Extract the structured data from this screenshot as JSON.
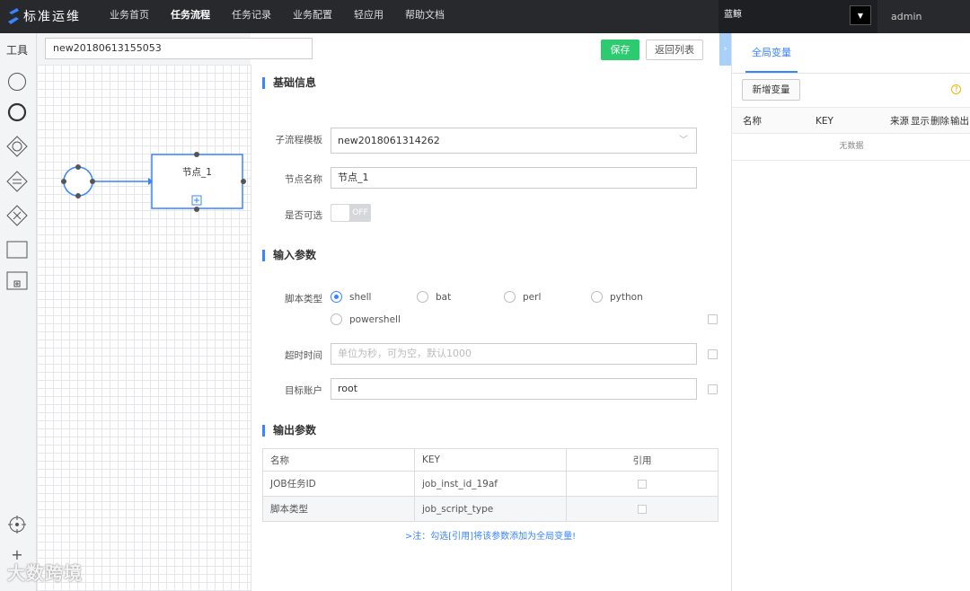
{
  "app": {
    "logo_text": "标准运维"
  },
  "nav": {
    "items": [
      "业务首页",
      "任务流程",
      "任务记录",
      "业务配置",
      "轻应用",
      "帮助文档"
    ],
    "active_index": 1
  },
  "header": {
    "business": "蓝鲸",
    "user": "admin"
  },
  "toolbox": {
    "title": "工具",
    "tools": [
      "start-node-icon",
      "end-node-icon",
      "parallel-gateway-icon",
      "branch-gateway-icon",
      "converge-gateway-icon",
      "task-node-icon",
      "subprocess-node-icon"
    ],
    "bottom_tools": [
      "locate-icon",
      "zoom-in-icon"
    ]
  },
  "flow": {
    "name": "new20180613155053",
    "save_label": "保存",
    "back_label": "返回列表"
  },
  "canvas": {
    "node_label": "节点_1"
  },
  "basic_info": {
    "title": "基础信息",
    "template_label": "子流程模板",
    "template_value": "new2018061314262",
    "node_name_label": "节点名称",
    "node_name_value": "节点_1",
    "optional_label": "是否可选",
    "optional_value": "OFF"
  },
  "input_params": {
    "title": "输入参数",
    "script_type_label": "脚本类型",
    "script_types": [
      "shell",
      "bat",
      "perl",
      "python",
      "powershell"
    ],
    "selected": "shell",
    "timeout_label": "超时时间",
    "timeout_placeholder": "单位为秒，可为空，默认1000",
    "account_label": "目标账户",
    "account_value": "root"
  },
  "output_params": {
    "title": "输出参数",
    "columns": [
      "名称",
      "KEY",
      "引用"
    ],
    "rows": [
      {
        "name": "JOB任务ID",
        "key": "job_inst_id_19af"
      },
      {
        "name": "脚本类型",
        "key": "job_script_type"
      }
    ],
    "note": ">注：勾选[引用]将该参数添加为全局变量!"
  },
  "global_vars": {
    "tab": "全局变量",
    "add_label": "新增变量",
    "help": "?",
    "columns": [
      "名称",
      "KEY",
      "来源",
      "显示",
      "删除",
      "输出"
    ],
    "empty": "无数据"
  },
  "watermark": "大数跨境",
  "colors": {
    "accent": "#3a84ff",
    "save": "#2dcb70",
    "topbar": "#27292c"
  }
}
